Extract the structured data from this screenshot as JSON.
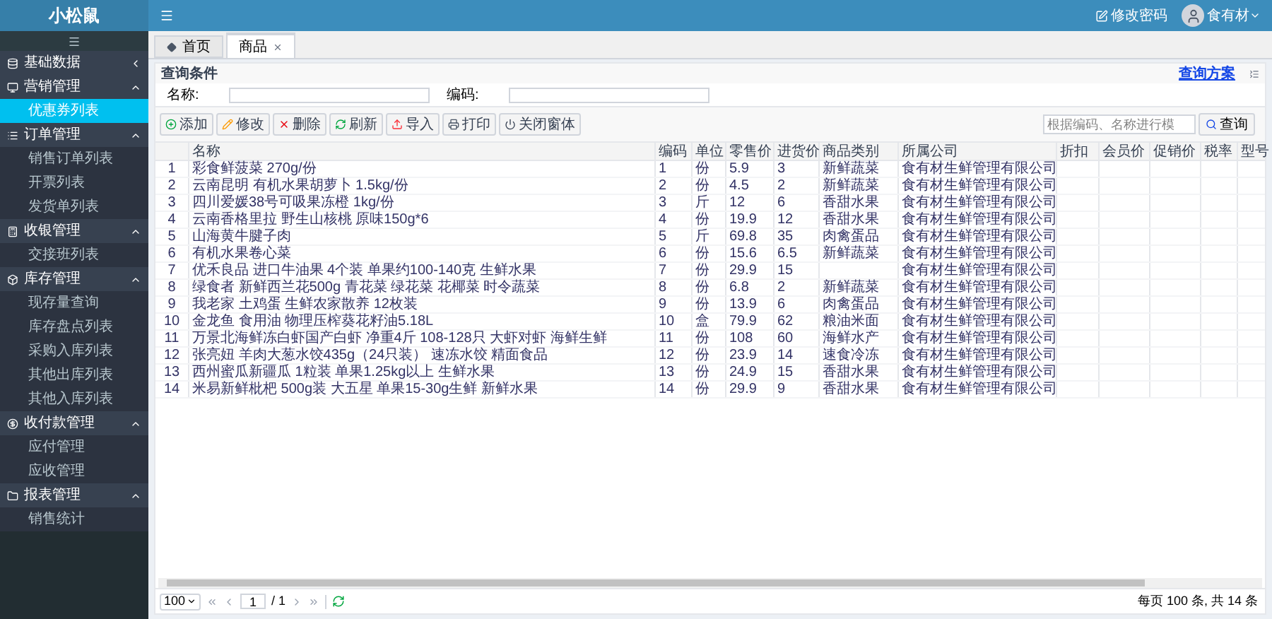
{
  "sidebar": {
    "title": "小松鼠",
    "groups": [
      {
        "label": "基础数据",
        "expanded": false
      },
      {
        "label": "营销管理",
        "expanded": true,
        "items": [
          {
            "label": "优惠券列表",
            "selected": true
          }
        ]
      },
      {
        "label": "订单管理",
        "expanded": true,
        "items": [
          {
            "label": "销售订单列表",
            "selected": false
          },
          {
            "label": "开票列表",
            "selected": false
          },
          {
            "label": "发货单列表",
            "selected": false
          }
        ]
      },
      {
        "label": "收银管理",
        "expanded": true,
        "items": [
          {
            "label": "交接班列表",
            "selected": false
          }
        ]
      },
      {
        "label": "库存管理",
        "expanded": true,
        "items": [
          {
            "label": "现存量查询",
            "selected": false
          },
          {
            "label": "库存盘点列表",
            "selected": false
          },
          {
            "label": "采购入库列表",
            "selected": false
          },
          {
            "label": "其他出库列表",
            "selected": false
          },
          {
            "label": "其他入库列表",
            "selected": false
          }
        ]
      },
      {
        "label": "收付款管理",
        "expanded": true,
        "items": [
          {
            "label": "应付管理",
            "selected": false
          },
          {
            "label": "应收管理",
            "selected": false
          }
        ]
      },
      {
        "label": "报表管理",
        "expanded": true,
        "items": [
          {
            "label": "销售统计",
            "selected": false
          }
        ]
      }
    ]
  },
  "header": {
    "change_password": "修改密码",
    "user": "食有材"
  },
  "tabs": [
    {
      "label": "首页",
      "selected": false,
      "closable": false
    },
    {
      "label": "商品",
      "selected": true,
      "closable": true
    }
  ],
  "query": {
    "title": "查询条件",
    "scheme_link": "查询方案",
    "fields": [
      {
        "label": "名称:"
      },
      {
        "label": "编码:"
      }
    ]
  },
  "toolbar": {
    "buttons": [
      "添加",
      "修改",
      "删除",
      "刷新",
      "导入",
      "打印",
      "关闭窗体"
    ],
    "search": {
      "placeholder": "根据编码、名称进行模"
    },
    "search_button": "查询"
  },
  "table": {
    "columns": [
      "",
      "名称",
      "编码",
      "单位",
      "零售价",
      "进货价",
      "商品类别",
      "所属公司",
      "折扣",
      "会员价",
      "促销价",
      "税率",
      "型号"
    ],
    "rows": [
      [
        "1",
        "彩食鲜菠菜 270g/份",
        "1",
        "份",
        "5.9",
        "3",
        "新鲜蔬菜",
        "食有材生鲜管理有限公司"
      ],
      [
        "2",
        "云南昆明 有机水果胡萝卜 1.5kg/份",
        "2",
        "份",
        "4.5",
        "2",
        "新鲜蔬菜",
        "食有材生鲜管理有限公司"
      ],
      [
        "3",
        "四川爱媛38号可吸果冻橙 1kg/份",
        "3",
        "斤",
        "12",
        "6",
        "香甜水果",
        "食有材生鲜管理有限公司"
      ],
      [
        "4",
        "云南香格里拉 野生山核桃 原味150g*6",
        "4",
        "份",
        "19.9",
        "12",
        "香甜水果",
        "食有材生鲜管理有限公司"
      ],
      [
        "5",
        "山海黄牛腱子肉",
        "5",
        "斤",
        "69.8",
        "35",
        "肉禽蛋品",
        "食有材生鲜管理有限公司"
      ],
      [
        "6",
        "有机水果卷心菜",
        "6",
        "份",
        "15.6",
        "6.5",
        "新鲜蔬菜",
        "食有材生鲜管理有限公司"
      ],
      [
        "7",
        "优禾良品 进口牛油果 4个装 单果约100-140克 生鲜水果",
        "7",
        "份",
        "29.9",
        "15",
        "",
        "食有材生鲜管理有限公司"
      ],
      [
        "8",
        "绿食者 新鲜西兰花500g 青花菜 绿花菜 花椰菜 时令蔬菜",
        "8",
        "份",
        "6.8",
        "2",
        "新鲜蔬菜",
        "食有材生鲜管理有限公司"
      ],
      [
        "9",
        "我老家 土鸡蛋 生鲜农家散养 12枚装",
        "9",
        "份",
        "13.9",
        "6",
        "肉禽蛋品",
        "食有材生鲜管理有限公司"
      ],
      [
        "10",
        "金龙鱼 食用油 物理压榨葵花籽油5.18L",
        "10",
        "盒",
        "79.9",
        "62",
        "粮油米面",
        "食有材生鲜管理有限公司"
      ],
      [
        "11",
        "万景北海鲜冻白虾国产白虾 净重4斤 108-128只 大虾对虾 海鲜生鲜",
        "11",
        "份",
        "108",
        "60",
        "海鲜水产",
        "食有材生鲜管理有限公司"
      ],
      [
        "12",
        "张亮妞 羊肉大葱水饺435g（24只装） 速冻水饺 精面食品",
        "12",
        "份",
        "23.9",
        "14",
        "速食冷冻",
        "食有材生鲜管理有限公司"
      ],
      [
        "13",
        "西州蜜瓜新疆瓜 1粒装 单果1.25kg以上 生鲜水果",
        "13",
        "份",
        "24.9",
        "15",
        "香甜水果",
        "食有材生鲜管理有限公司"
      ],
      [
        "14",
        "米易新鲜枇杷 500g装 大五星 单果15-30g生鲜 新鲜水果",
        "14",
        "份",
        "29.9",
        "9",
        "香甜水果",
        "食有材生鲜管理有限公司"
      ]
    ]
  },
  "pagination": {
    "page_size": "100",
    "page": "1",
    "total_pages": "/ 1",
    "summary": "每页 100 条, 共 14 条"
  }
}
